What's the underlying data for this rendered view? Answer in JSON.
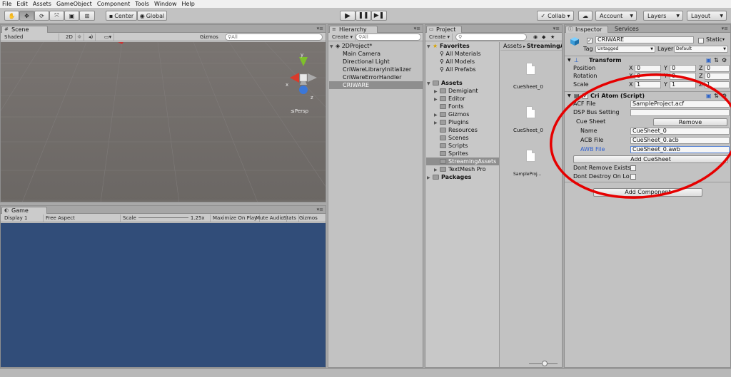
{
  "menu": [
    "File",
    "Edit",
    "Assets",
    "GameObject",
    "Component",
    "Tools",
    "Window",
    "Help"
  ],
  "toolbar": {
    "center_label": "Center",
    "global_label": "Global",
    "collab_label": "Collab ▾",
    "account_label": "Account",
    "layers_label": "Layers",
    "layout_label": "Layout"
  },
  "scene": {
    "tab_label": "Scene",
    "shading": "Shaded",
    "mode_2d": "2D",
    "gizmos": "Gizmos",
    "search_placeholder": "All",
    "persp_label": "Persp",
    "axis_x": "x",
    "axis_y": "y",
    "axis_z": "z"
  },
  "game": {
    "tab_label": "Game",
    "display": "Display 1",
    "aspect": "Free Aspect",
    "scale_label": "Scale",
    "scale_value": "1.25x",
    "maximize": "Maximize On Play",
    "mute": "Mute Audio",
    "stats": "Stats",
    "gizmos": "Gizmos",
    "background_color": "#314d79"
  },
  "hierarchy": {
    "tab_label": "Hierarchy",
    "create": "Create",
    "search_placeholder": "All",
    "project_name": "2DProject*",
    "items": [
      "Main Camera",
      "Directional Light",
      "CriWareLibraryInitializer",
      "CriWareErrorHandler",
      "CRIWARE"
    ]
  },
  "project": {
    "tab_label": "Project",
    "create": "Create",
    "favorites_label": "Favorites",
    "favorites": [
      "All Materials",
      "All Models",
      "All Prefabs"
    ],
    "assets_label": "Assets",
    "folders": [
      "Demigiant",
      "Editor",
      "Fonts",
      "Gizmos",
      "Plugins",
      "Resources",
      "Scenes",
      "Scripts",
      "Sprites",
      "StreamingAssets",
      "TextMesh Pro"
    ],
    "packages_label": "Packages",
    "breadcrumb_root": "Assets",
    "breadcrumb_current": "StreamingA",
    "files": [
      "CueSheet_0",
      "CueSheet_0",
      "SampleProj..."
    ]
  },
  "inspector": {
    "tab_label": "Inspector",
    "services_label": "Services",
    "object_name": "CRIWARE",
    "static_label": "Static",
    "tag_label": "Tag",
    "tag_value": "Untagged",
    "layer_label": "Layer",
    "layer_value": "Default",
    "transform_label": "Transform",
    "position_label": "Position",
    "rotation_label": "Rotation",
    "scale_label": "Scale",
    "position": [
      "0",
      "0",
      "0"
    ],
    "rotation": [
      "0",
      "0",
      "0"
    ],
    "scale": [
      "1",
      "1",
      "1"
    ],
    "script_label": "Cri Atom (Script)",
    "acf_label": "ACF File",
    "acf_value": "SampleProject.acf",
    "dsp_label": "DSP Bus Setting",
    "cue_sheet_label": "Cue Sheet",
    "remove_label": "Remove",
    "name_label": "Name",
    "name_value": "CueSheet_0",
    "acb_label": "ACB File",
    "acb_value": "CueSheet_0.acb",
    "awb_label": "AWB File",
    "awb_value": "CueSheet_0.awb",
    "add_cue_sheet": "Add CueSheet",
    "dont_remove": "Dont Remove Exists",
    "dont_destroy": "Dont Destroy On Lo",
    "add_component": "Add Component",
    "highlight_color": "#e60000"
  }
}
